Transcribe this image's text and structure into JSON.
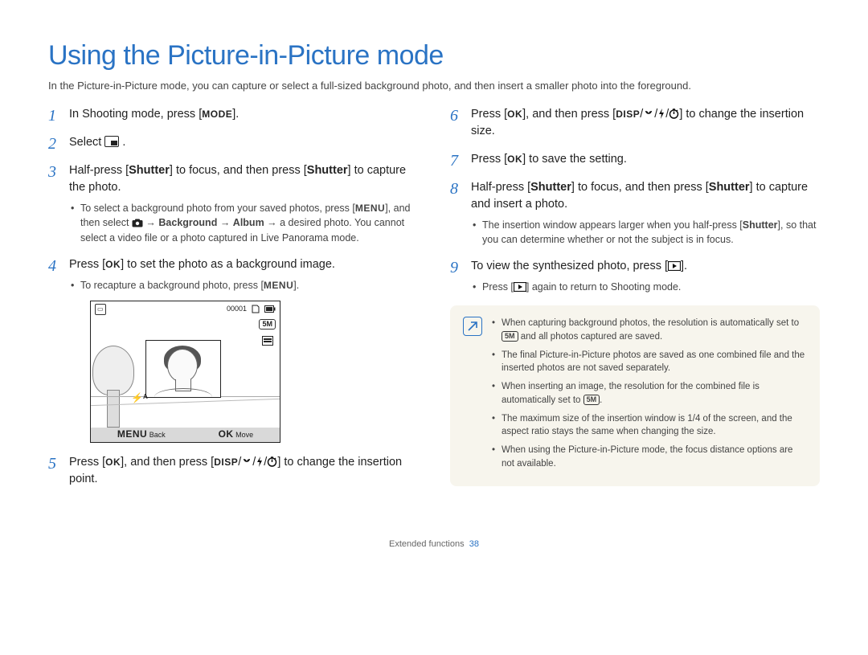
{
  "title": "Using the Picture-in-Picture mode",
  "intro": "In the Picture-in-Picture mode, you can capture or select a full-sized background photo, and then insert a smaller photo into the foreground.",
  "left": {
    "s1": {
      "num": "1",
      "a": "In Shooting mode, press [",
      "b": "MODE",
      "c": "]."
    },
    "s2": {
      "num": "2",
      "a": "Select ",
      "b": "."
    },
    "s3": {
      "num": "3",
      "a": "Half-press [",
      "shutter1": "Shutter",
      "b": "] to focus, and then press [",
      "shutter2": "Shutter",
      "c": "] to capture the photo.",
      "sub_a": "To select a background photo from your saved photos, press [",
      "sub_menu": "MENU",
      "sub_b": "], and then select ",
      "sub_bg": "Background",
      "sub_arrow": " → ",
      "sub_album": "Album",
      "sub_c": " → a desired photo. You cannot select a video file or a photo captured in Live Panorama mode."
    },
    "s4": {
      "num": "4",
      "a": "Press [",
      "ok": "OK",
      "b": "] to set the photo as a background image.",
      "sub_a": "To recapture a background photo, press [",
      "sub_menu": "MENU",
      "sub_b": "]."
    },
    "screen": {
      "counter": "00001",
      "back": "Back",
      "move": "Move",
      "menu": "MENU",
      "ok": "OK",
      "res": "5M",
      "flash": "⚡ᴬ"
    },
    "s5": {
      "num": "5",
      "a": "Press [",
      "ok": "OK",
      "b": "], and then press [",
      "disp": "DISP",
      "c": "] to change the insertion point."
    }
  },
  "right": {
    "s6": {
      "num": "6",
      "a": "Press [",
      "ok": "OK",
      "b": "], and then press [",
      "disp": "DISP",
      "c": "] to change the insertion size."
    },
    "s7": {
      "num": "7",
      "a": "Press [",
      "ok": "OK",
      "b": "] to save the setting."
    },
    "s8": {
      "num": "8",
      "a": "Half-press [",
      "shutter1": "Shutter",
      "b": "] to focus, and then press [",
      "shutter2": "Shutter",
      "c": "] to capture and insert a photo.",
      "sub_a": "The insertion window appears larger when you half-press [",
      "sub_shutter": "Shutter",
      "sub_b": "], so that you can determine whether or not the subject is in focus."
    },
    "s9": {
      "num": "9",
      "a": "To view the synthesized photo, press [",
      "b": "].",
      "sub_a": "Press [",
      "sub_b": "] again to return to Shooting mode."
    },
    "notes": {
      "n1a": "When capturing background photos, the resolution is automatically set to ",
      "chip": "5M",
      "n1b": " and all photos captured are saved.",
      "n2": "The final Picture-in-Picture photos are saved as one combined file and the inserted photos are not saved separately.",
      "n3a": "When inserting an image, the resolution for the combined file is automatically set to ",
      "n3b": ".",
      "n4": "The maximum size of the insertion window is 1/4 of the screen, and the aspect ratio stays the same when changing the size.",
      "n5": "When using the Picture-in-Picture mode, the focus distance options are not available."
    }
  },
  "footer": {
    "section": "Extended functions",
    "page": "38"
  }
}
